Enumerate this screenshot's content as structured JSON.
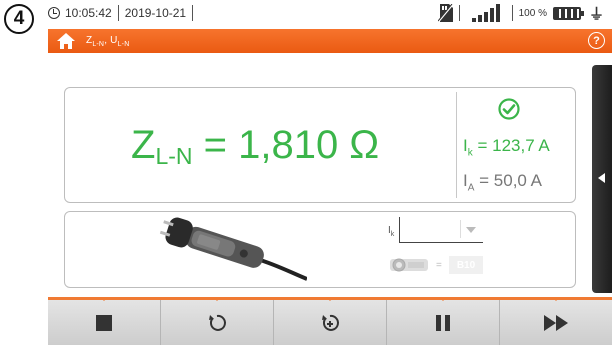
{
  "step_badge": "4",
  "status_bar": {
    "time": "10:05:42",
    "date": "2019-10-21",
    "battery_percent": "100 %",
    "icons": [
      "clock-icon",
      "sd-card-icon",
      "signal-strength-icon",
      "battery-icon",
      "mains-plug-icon"
    ]
  },
  "header": {
    "title_main": "Z",
    "title_sub1": "L-N",
    "title_sep": ", U",
    "title_sub2": "L-N",
    "help_label": "?",
    "icons": [
      "home-icon",
      "help-icon"
    ]
  },
  "result": {
    "main_symbol": "Z",
    "main_sub": "L-N",
    "main_value": " = 1,810 Ω",
    "ik_symbol": "I",
    "ik_sub": "k",
    "ik_value": " = 123,7 A",
    "ia_symbol": "I",
    "ia_sub": "A",
    "ia_value": " = 50,0 A",
    "status_icon": "check-circle-icon"
  },
  "settings": {
    "ik_label": "I",
    "ik_label_sub": "k",
    "ik_select_value": "",
    "fuse_eq": "=",
    "fuse_value": "B10"
  },
  "toolbar": {
    "buttons": [
      "stop",
      "reset",
      "reset-options",
      "pause",
      "fast-forward"
    ]
  },
  "colors": {
    "accent_orange": "#ea5a12",
    "result_green": "#3bb54a",
    "secondary_gray": "#777777"
  }
}
